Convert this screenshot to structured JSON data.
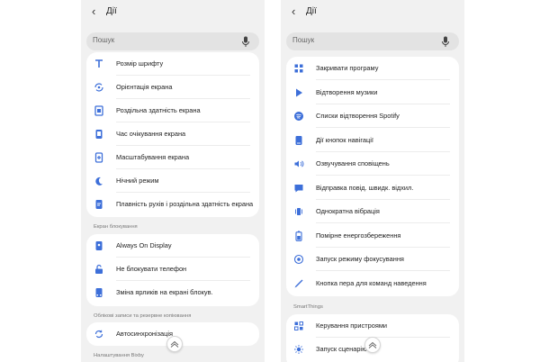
{
  "left": {
    "title": "Дії",
    "search_placeholder": "Пошук",
    "group1": [
      {
        "label": "Розмір шрифту",
        "icon": "font-size-icon"
      },
      {
        "label": "Орієнтація екрана",
        "icon": "rotate-icon"
      },
      {
        "label": "Роздільна здатність екрана",
        "icon": "resolution-icon"
      },
      {
        "label": "Час очікування екрана",
        "icon": "screen-timeout-icon"
      },
      {
        "label": "Масштабування екрана",
        "icon": "zoom-icon"
      },
      {
        "label": "Нічний режим",
        "icon": "moon-icon"
      },
      {
        "label": "Плавність рухів і роздільна здатність екрана",
        "icon": "motion-smoothness-icon"
      }
    ],
    "section_lock": "Екран блокування",
    "group2": [
      {
        "label": "Always On Display",
        "icon": "always-on-display-icon"
      },
      {
        "label": "Не блокувати телефон",
        "icon": "unlock-icon"
      },
      {
        "label": "Зміна ярликів на екрані блокув.",
        "icon": "shortcuts-icon"
      }
    ],
    "section_accounts": "Облікові записи та резервне копіювання",
    "group3": [
      {
        "label": "Автосинхронізація",
        "icon": "sync-icon"
      }
    ],
    "section_bixby": "Налаштування Bixby"
  },
  "right": {
    "title": "Дії",
    "search_placeholder": "Пошук",
    "group1": [
      {
        "label": "Закривати програму",
        "icon": "close-app-icon"
      },
      {
        "label": "Відтворення музики",
        "icon": "play-icon"
      },
      {
        "label": "Списки відтворення Spotify",
        "icon": "spotify-icon"
      },
      {
        "label": "Дії кнопок навігації",
        "icon": "navigation-buttons-icon"
      },
      {
        "label": "Озвучування сповіщень",
        "icon": "read-notifications-icon"
      },
      {
        "label": "Відправка повід. швидк. відхил.",
        "icon": "quick-decline-message-icon"
      },
      {
        "label": "Однократна вібрація",
        "icon": "vibration-icon"
      },
      {
        "label": "Помірне енергозбереження",
        "icon": "battery-saver-icon"
      },
      {
        "label": "Запуск режиму фокусування",
        "icon": "focus-mode-icon"
      },
      {
        "label": "Кнопка пера для команд наведення",
        "icon": "pen-icon"
      }
    ],
    "section_smartthings": "SmartThings",
    "group2": [
      {
        "label": "Керування пристроями",
        "icon": "devices-icon"
      },
      {
        "label": "Запуск сценарію",
        "icon": "scene-icon"
      }
    ]
  },
  "colors": {
    "accent": "#3d6fd9",
    "background": "#f1f1f1",
    "card": "#ffffff"
  }
}
